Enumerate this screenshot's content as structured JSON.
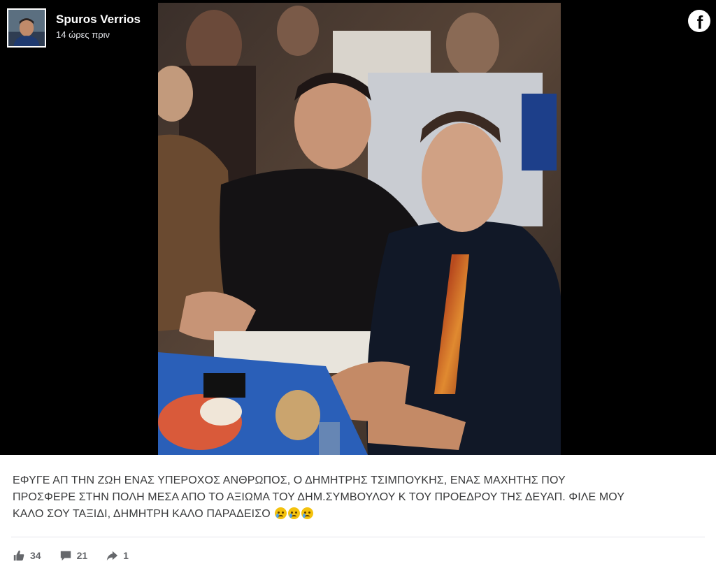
{
  "post": {
    "author": "Spuros Verrios",
    "time": "14 ώρες πριν",
    "caption_line1": "ΕΦΥΓΕ ΑΠ ΤΗΝ ΖΩΗ ΕΝΑΣ ΥΠΕΡΟΧΟΣ ΑΝΘΡΩΠΟΣ, Ο ΔΗΜΗΤΡΗΣ ΤΣΙΜΠΟΥΚΗΣ, ΕΝΑΣ ΜΑΧΗΤΗΣ ΠΟΥ",
    "caption_line2": "ΠΡΟΣΦΕΡΕ ΣΤΗΝ ΠΟΛΗ ΜΕΣΑ ΑΠΟ ΤΟ ΑΞΙΩΜΑ ΤΟΥ ΔΗΜ.ΣΥΜΒΟΥΛΟΥ Κ ΤΟΥ ΠΡΟΕΔΡΟΥ ΤΗΣ ΔΕΥΑΠ. ΦΙΛΕ ΜΟΥ",
    "caption_line3": "ΚΑΛΟ ΣΟΥ ΤΑΞΙΔΙ, ΔΗΜΗΤΡΗ ΚΑΛΟ ΠΑΡΑΔΕΙΣΟ",
    "caption_emoji": [
      "crying-face-icon",
      "crying-face-icon",
      "crying-face-icon"
    ]
  },
  "platform": {
    "logo_letter": "f",
    "brand_color": "#ffffff"
  },
  "stats": {
    "likes": "34",
    "comments": "21",
    "shares": "1"
  },
  "icons": {
    "like": "thumbs-up-icon",
    "comment": "comment-icon",
    "share": "share-icon"
  }
}
